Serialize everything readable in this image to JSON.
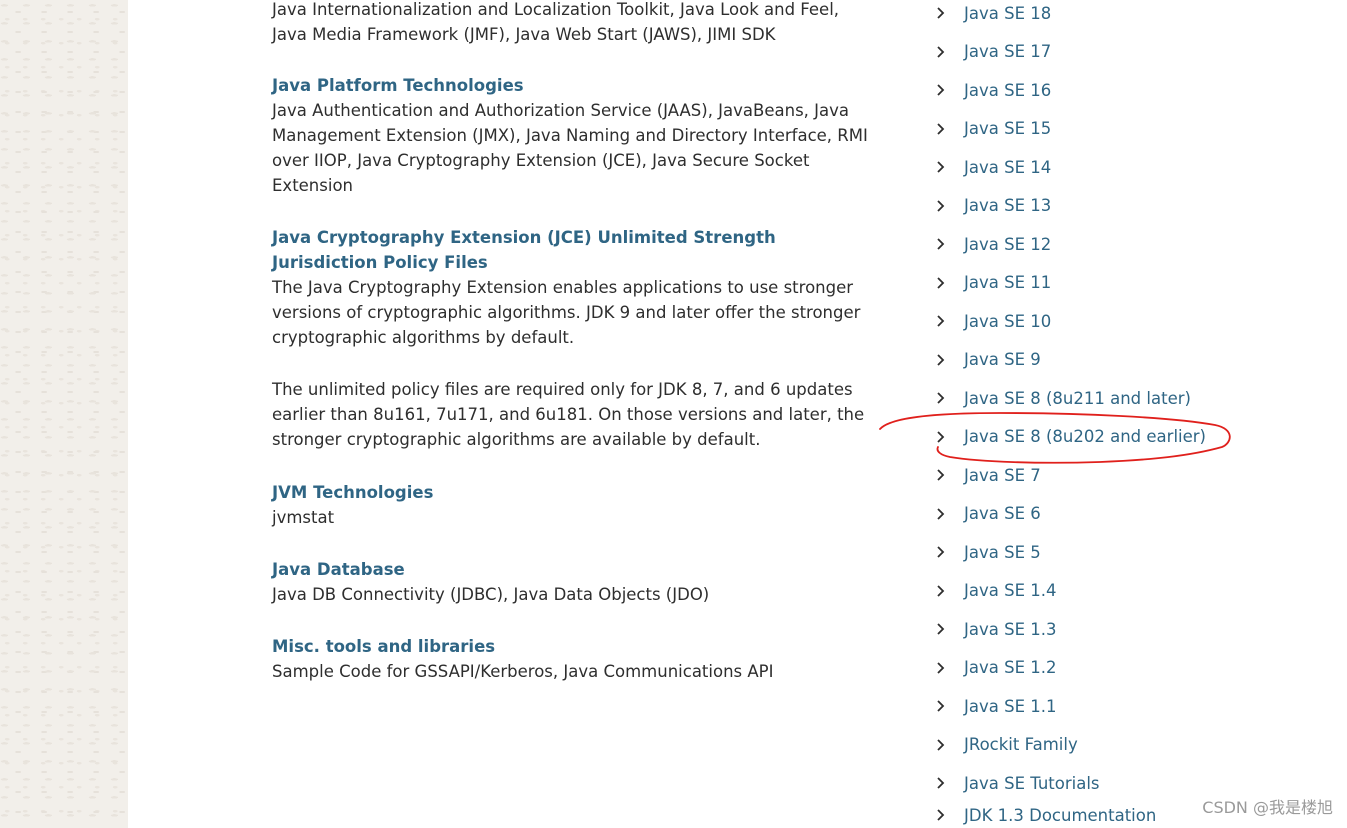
{
  "sections": [
    {
      "title": "",
      "desc": "Java Internationalization and Localization Toolkit, Java Look and Feel, Java Media Framework (JMF), Java Web Start (JAWS), JIMI SDK"
    },
    {
      "title": "Java Platform Technologies",
      "desc": "Java Authentication and Authorization Service (JAAS), JavaBeans, Java Management Extension (JMX), Java Naming and Directory Interface, RMI over IIOP, Java Cryptography Extension (JCE), Java Secure Socket Extension"
    },
    {
      "title": "Java Cryptography Extension (JCE) Unlimited Strength Jurisdiction Policy Files",
      "desc": "The Java Cryptography Extension enables applications to use stronger versions of cryptographic algorithms. JDK 9 and later offer the stronger cryptographic algorithms by default.",
      "desc2": "The unlimited policy files are required only for JDK 8, 7, and 6 updates earlier than 8u161, 7u171, and 6u181. On those versions and later, the stronger cryptographic algorithms are available by default."
    },
    {
      "title": "JVM Technologies",
      "desc": "jvmstat"
    },
    {
      "title": "Java Database",
      "desc": "Java DB Connectivity (JDBC), Java Data Objects (JDO)"
    },
    {
      "title": "Misc. tools and libraries",
      "desc": "Sample Code for GSSAPI/Kerberos, Java Communications API"
    }
  ],
  "nav": [
    "Java SE 18",
    "Java SE 17",
    "Java SE 16",
    "Java SE 15",
    "Java SE 14",
    "Java SE 13",
    "Java SE 12",
    "Java SE 11",
    "Java SE 10",
    "Java SE 9",
    "Java SE 8 (8u211 and later)",
    "Java SE 8 (8u202 and earlier)",
    "Java SE 7",
    "Java SE 6",
    "Java SE 5",
    "Java SE 1.4",
    "Java SE 1.3",
    "Java SE 1.2",
    "Java SE 1.1",
    "JRockit Family",
    "Java SE Tutorials",
    "JDK 1.3 Documentation"
  ],
  "highlighted_nav_item": "Java SE 8 (8u202 and earlier)",
  "watermark": "CSDN @我是楼旭",
  "colors": {
    "link": "#2f6584",
    "text": "#2e2e2e",
    "annotation": "#e0201c",
    "side_background": "#f2efea"
  }
}
